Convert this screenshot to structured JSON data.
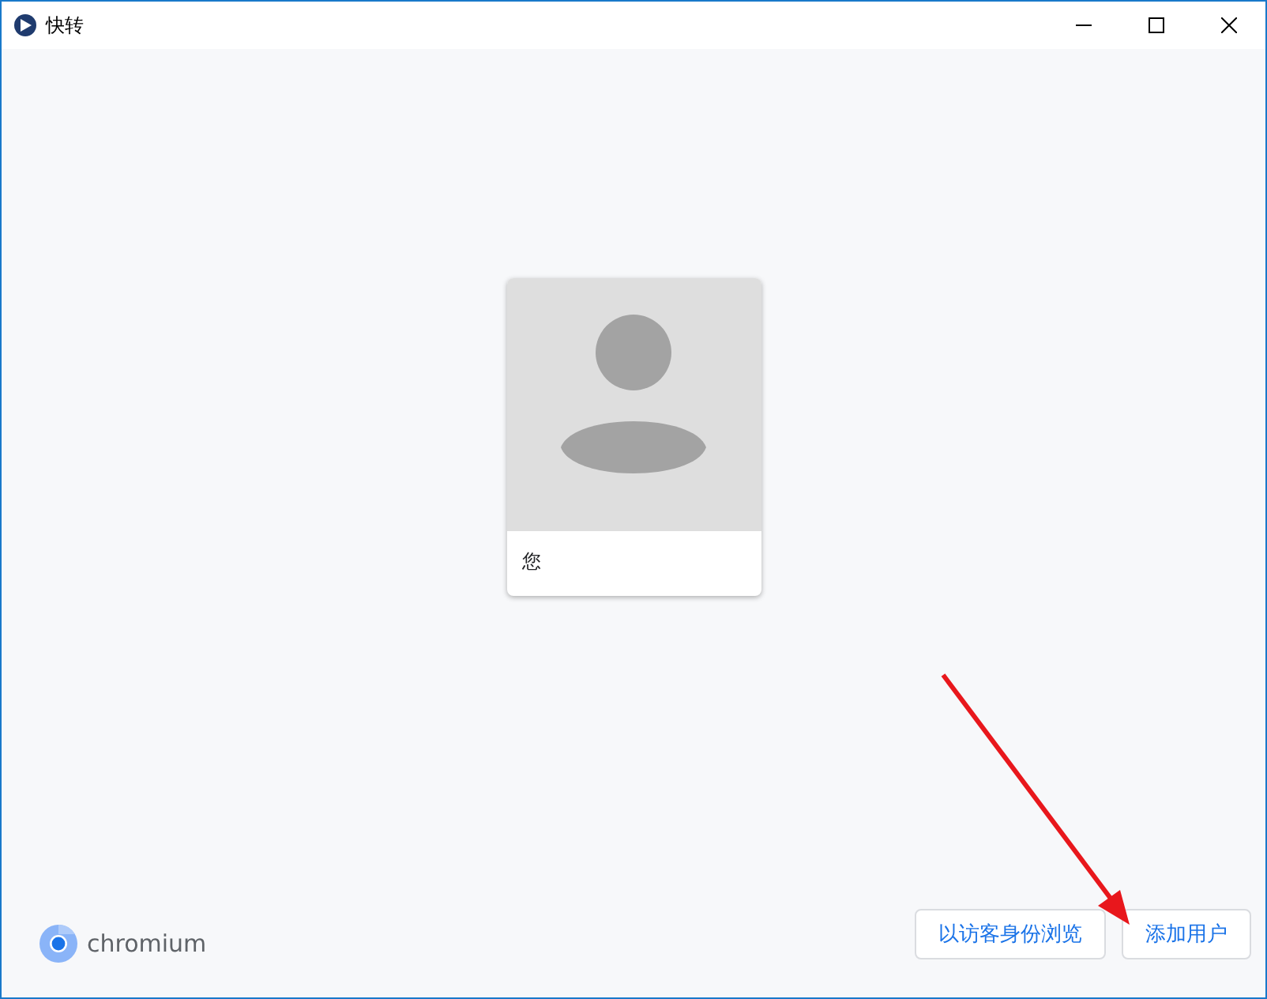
{
  "window": {
    "title": "快转"
  },
  "profiles": [
    {
      "name": "您"
    }
  ],
  "brand": {
    "name": "chromium"
  },
  "buttons": [
    {
      "label": "以访客身份浏览"
    },
    {
      "label": "添加用户"
    }
  ]
}
